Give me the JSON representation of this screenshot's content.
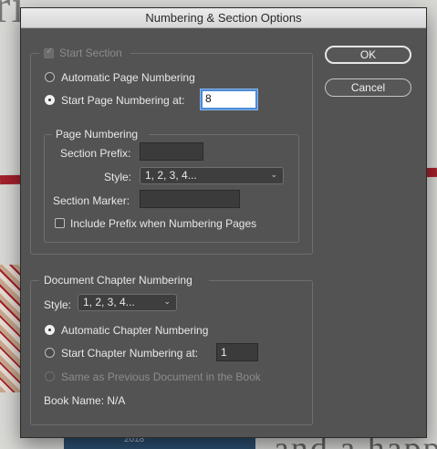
{
  "dialog": {
    "title": "Numbering & Section Options"
  },
  "section": {
    "start_section_label": "Start Section",
    "auto_page_numbering_label": "Automatic Page Numbering",
    "start_page_numbering_label": "Start Page Numbering at:",
    "start_page_value": "8"
  },
  "page_numbering": {
    "group_title": "Page Numbering",
    "section_prefix_label": "Section Prefix:",
    "section_prefix_value": "",
    "style_label": "Style:",
    "style_value": "1, 2, 3, 4...",
    "section_marker_label": "Section Marker:",
    "section_marker_value": "",
    "include_prefix_label": "Include Prefix when Numbering Pages"
  },
  "chapter": {
    "group_title": "Document Chapter Numbering",
    "style_label": "Style:",
    "style_value": "1, 2, 3, 4...",
    "auto_chapter_label": "Automatic Chapter Numbering",
    "start_chapter_label": "Start Chapter Numbering at:",
    "start_chapter_value": "1",
    "same_as_previous_label": "Same as Previous Document in the Book",
    "book_name_label": "Book Name: N/A"
  },
  "buttons": {
    "ok": "OK",
    "cancel": "Cancel"
  },
  "background": {
    "top_text": "ri",
    "bottom_text": "and a happy",
    "year": "2018"
  },
  "colors": {
    "dialog_bg": "#535353",
    "focus_ring": "#4b8bd6",
    "accent_red": "#a4202c"
  }
}
